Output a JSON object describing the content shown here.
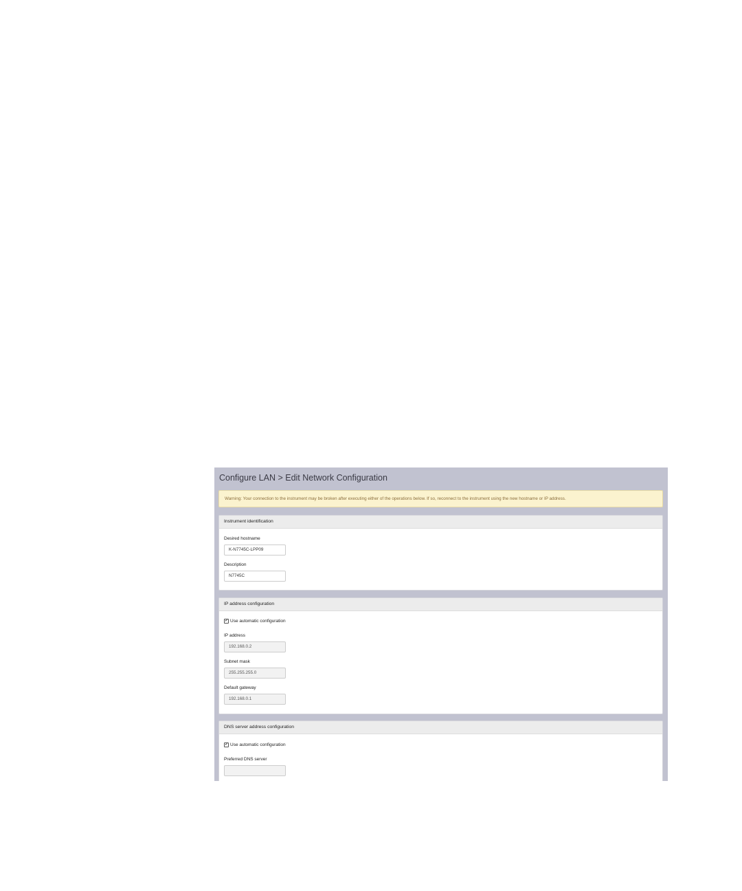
{
  "page": {
    "title": "Configure LAN > Edit Network Configuration"
  },
  "warning": {
    "text": "Warning: Your connection to the instrument may be broken after executing either of the operations below. If so, reconnect to the instrument using the new hostname or IP address."
  },
  "identification": {
    "heading": "Instrument identification",
    "hostname_label": "Desired hostname",
    "hostname_value": "K-N7745C-LPP09",
    "description_label": "Description",
    "description_value": "N7745C"
  },
  "ip_config": {
    "heading": "IP address configuration",
    "auto_label": "Use automatic configuration",
    "auto_checked": true,
    "ip_label": "IP address",
    "ip_value": "192.168.0.2",
    "subnet_label": "Subnet mask",
    "subnet_value": "255.255.255.0",
    "gateway_label": "Default gateway",
    "gateway_value": "192.168.0.1"
  },
  "dns_config": {
    "heading": "DNS server address configuration",
    "auto_label": "Use automatic configuration",
    "auto_checked": true,
    "preferred_label": "Preferred DNS server",
    "preferred_value": ""
  },
  "icons": {
    "checkmark": "✔"
  },
  "colors": {
    "frame_background": "#c1c2d0",
    "warning_background": "#fbf3cf",
    "warning_text": "#8a6d3b",
    "panel_heading_background": "#ececec"
  }
}
